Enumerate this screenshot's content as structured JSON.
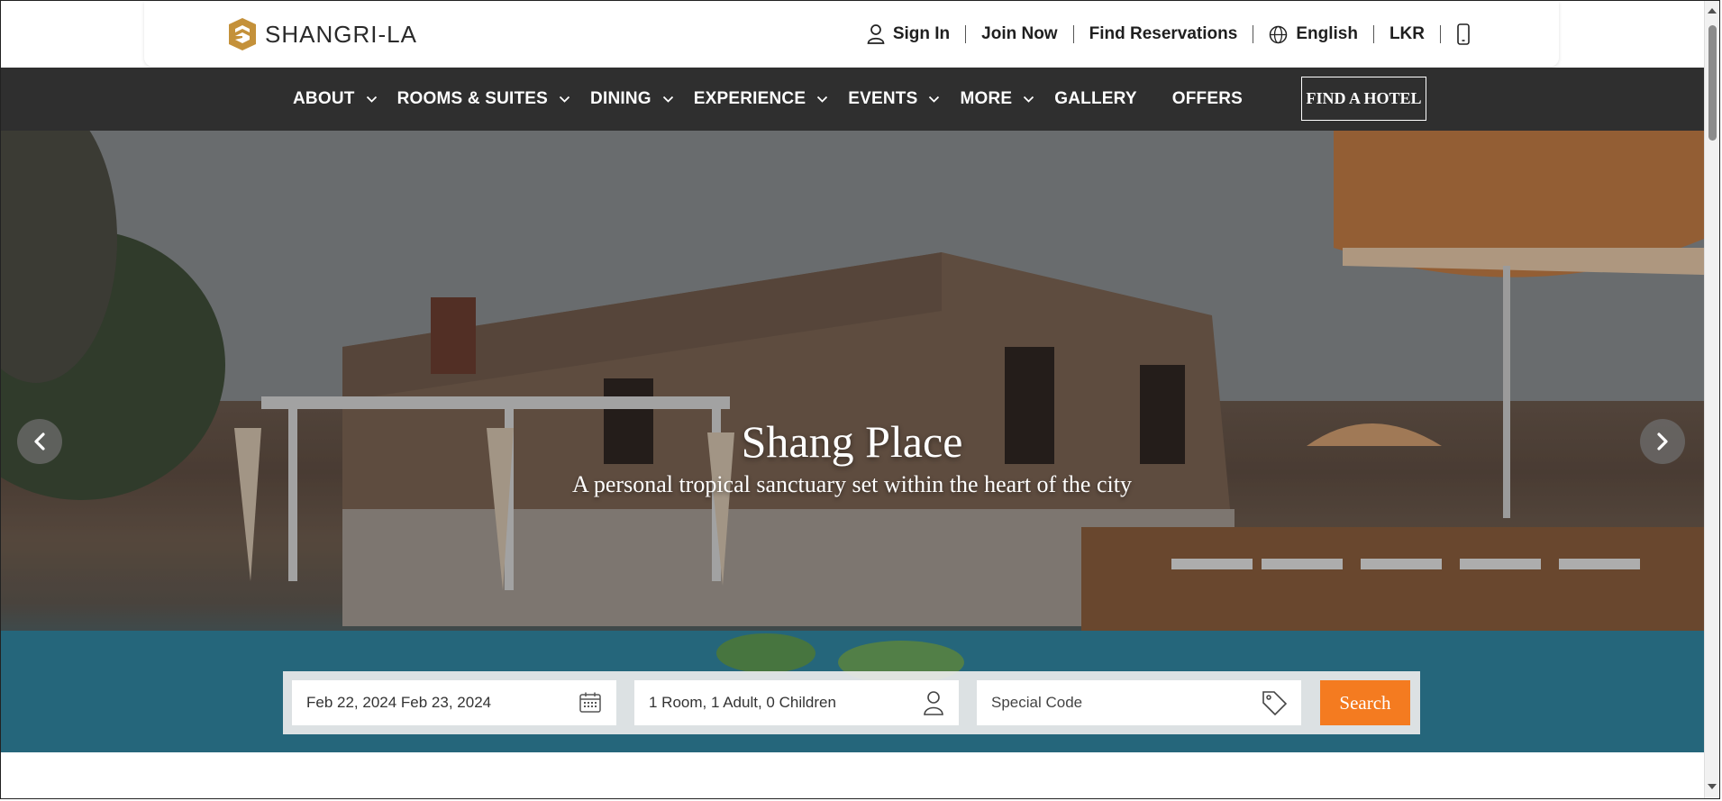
{
  "brand": {
    "name": "SHANGRI-LA",
    "logo_color": "#c4913a"
  },
  "utility": {
    "sign_in": "Sign In",
    "join_now": "Join Now",
    "find_reservations": "Find Reservations",
    "language": "English",
    "currency": "LKR"
  },
  "nav": {
    "items": [
      {
        "label": "ABOUT",
        "has_dropdown": true
      },
      {
        "label": "ROOMS & SUITES",
        "has_dropdown": true
      },
      {
        "label": "DINING",
        "has_dropdown": true
      },
      {
        "label": "EXPERIENCE",
        "has_dropdown": true
      },
      {
        "label": "EVENTS",
        "has_dropdown": true
      },
      {
        "label": "MORE",
        "has_dropdown": true
      },
      {
        "label": "GALLERY",
        "has_dropdown": false
      },
      {
        "label": "OFFERS",
        "has_dropdown": false
      }
    ],
    "find_hotel": "FIND A HOTEL"
  },
  "hero": {
    "title": "Shang Place",
    "subtitle": "A personal tropical sanctuary set within the heart of the city"
  },
  "booking": {
    "dates": "Feb 22, 2024 Feb 23, 2024",
    "guests": "1 Room, 1 Adult, 0 Children",
    "special_code_placeholder": "Special Code",
    "search_label": "Search",
    "accent": "#f47b20"
  }
}
